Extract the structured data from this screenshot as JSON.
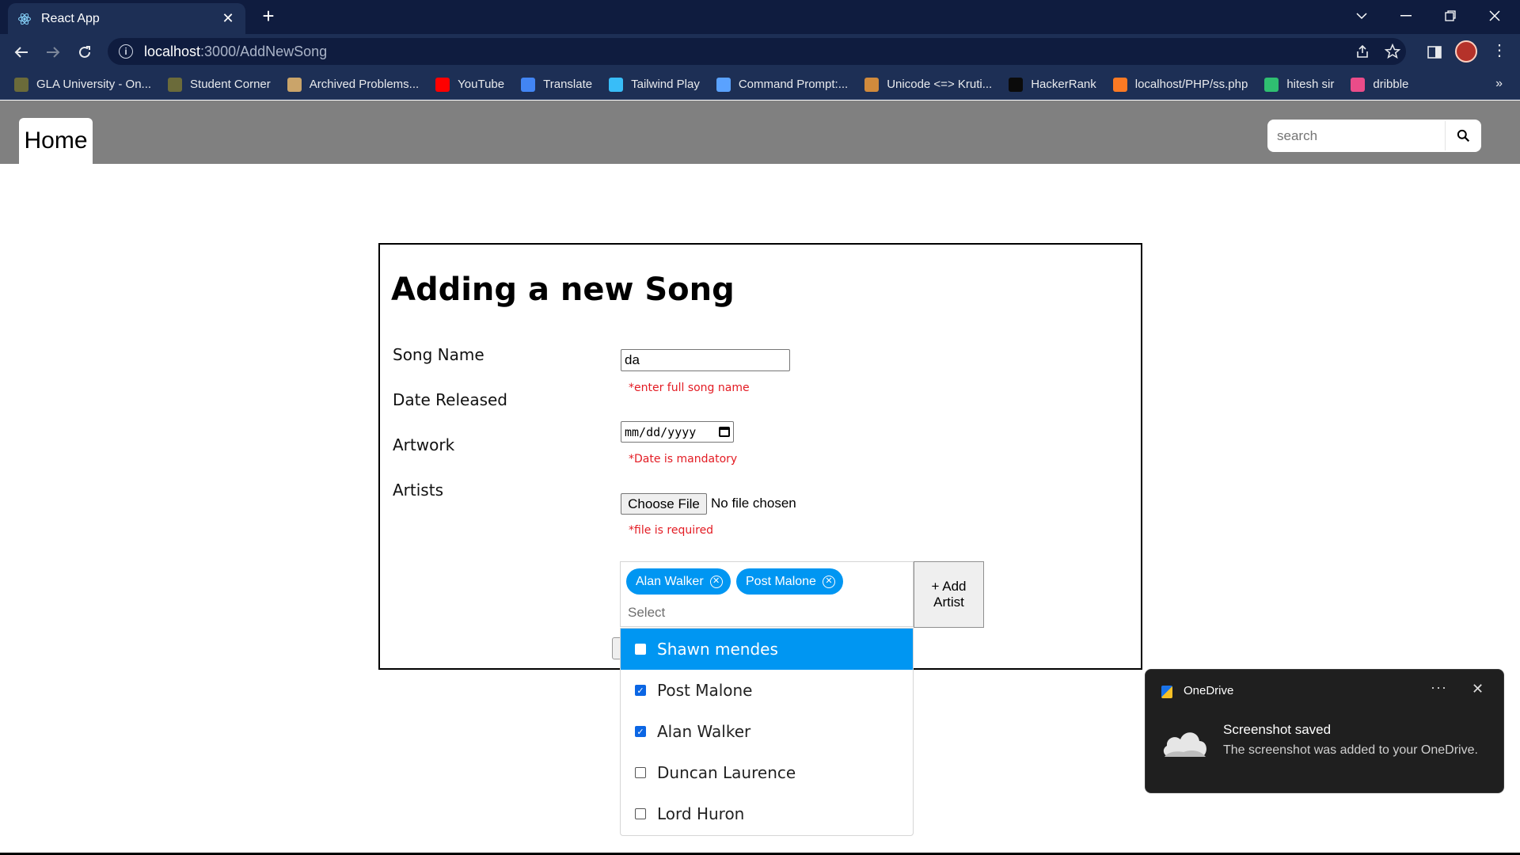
{
  "browser": {
    "tab_title": "React App",
    "url_host": "localhost",
    "url_path": ":3000/AddNewSong",
    "bookmarks": [
      {
        "label": "GLA University - On...",
        "icon": "gla-icon",
        "color": "#6b6b3a"
      },
      {
        "label": "Student Corner",
        "icon": "gla-icon",
        "color": "#6b6b3a"
      },
      {
        "label": "Archived Problems...",
        "icon": "pe-icon",
        "color": "#caa46a"
      },
      {
        "label": "YouTube",
        "icon": "youtube-icon",
        "color": "#ff0000"
      },
      {
        "label": "Translate",
        "icon": "translate-icon",
        "color": "#4285f4"
      },
      {
        "label": "Tailwind Play",
        "icon": "tailwind-icon",
        "color": "#38bdf8"
      },
      {
        "label": "Command Prompt:...",
        "icon": "anchor-icon",
        "color": "#5aa2ff"
      },
      {
        "label": "Unicode <=> Kruti...",
        "icon": "unicode-icon",
        "color": "#d08a3c"
      },
      {
        "label": "HackerRank",
        "icon": "hackerrank-icon",
        "color": "#0b0b0b"
      },
      {
        "label": "localhost/PHP/ss.php",
        "icon": "xampp-icon",
        "color": "#fb7a24"
      },
      {
        "label": "hitesh sir",
        "icon": "code-icon",
        "color": "#2fbf71"
      },
      {
        "label": "dribble",
        "icon": "dribbble-icon",
        "color": "#ea4c89"
      }
    ]
  },
  "app": {
    "home_label": "Home",
    "search_placeholder": "search"
  },
  "form": {
    "title": "Adding a new Song",
    "labels": {
      "song_name": "Song Name",
      "date_released": "Date Released",
      "artwork": "Artwork",
      "artists": "Artists"
    },
    "song_name_value": "da",
    "song_name_error": "*enter full song name",
    "date_placeholder": "mm/dd/yyyy",
    "date_error": "*Date is mandatory",
    "file_button": "Choose File",
    "file_status": "No file chosen",
    "file_error": "*file is required",
    "selected_artists": [
      "Alan Walker",
      "Post Malone"
    ],
    "select_placeholder": "Select",
    "add_artist_label": "+ Add Artist",
    "options": [
      {
        "label": "Shawn mendes",
        "checked": false,
        "highlighted": true
      },
      {
        "label": "Post Malone",
        "checked": true,
        "highlighted": false
      },
      {
        "label": "Alan Walker",
        "checked": true,
        "highlighted": false
      },
      {
        "label": "Duncan Laurence",
        "checked": false,
        "highlighted": false
      },
      {
        "label": "Lord Huron",
        "checked": false,
        "highlighted": false
      }
    ]
  },
  "toast": {
    "app_name": "OneDrive",
    "heading": "Screenshot saved",
    "body": "The screenshot was added to your OneDrive."
  },
  "colors": {
    "chip": "#0096f2",
    "error": "#e31b23",
    "nav": "#808080"
  }
}
